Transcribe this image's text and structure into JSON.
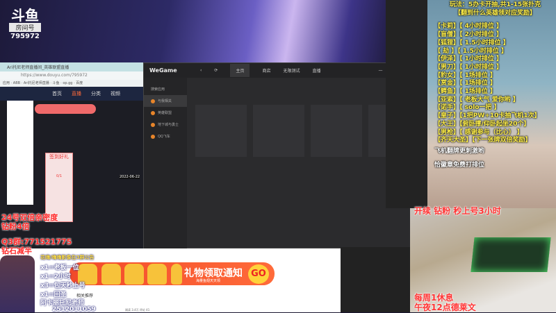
{
  "overlay": {
    "logo": "斗鱼",
    "room_label": "房间号",
    "room_id": "795972"
  },
  "browser": {
    "tab_title": "Ari托尼老师直播间_英雄联盟直播",
    "url": "https://www.douyu.com/795972",
    "bookmarks": [
      "应用",
      "ABB",
      "Ari托尼老师直播",
      "斗鱼",
      "op.gg",
      "百度"
    ],
    "nav": [
      "首页",
      "直播",
      "分类",
      "视频"
    ],
    "date": "2022-06-22",
    "gift_title": "签到好礼",
    "gift_count": "0/1"
  },
  "wegame": {
    "logo": "WeGame",
    "tabs": [
      "主页",
      "商店",
      "无限测试",
      "直播"
    ],
    "search": "搜索应用",
    "sidebar": [
      "与我相关",
      "英雄联盟",
      "地下城与勇士",
      "QQ飞车"
    ]
  },
  "rules": {
    "title": "玩法：5办卡开抽,共1-15张扑克",
    "subtitle": "【翻到什么英雄领对应奖励】",
    "items": [
      [
        "【卡莉】",
        "【  4小时排位  】"
      ],
      [
        "【盲僧】",
        "【  2小时排位  】"
      ],
      [
        "【狐狸】",
        "【 1.5小时排位 】"
      ],
      [
        "【 劫 】",
        "【 1.5小时排位 】"
      ],
      [
        "【伊泽】",
        "【  1小时排位  】"
      ],
      [
        "【男刀】",
        "【  1小时排位  】"
      ],
      [
        "【豹女】",
        "【  1场排位  】"
      ],
      [
        "【赏金】",
        "【  1场排位  】"
      ],
      [
        "【鳄鱼】",
        "【  1场排位  】"
      ],
      [
        "【亚索】",
        "【 老板大气 爱你哟 】"
      ],
      [
        "【诺手】",
        "【  solo一把  】"
      ],
      [
        "【皇子】",
        "【1把PW+10卡抽飞机1次】"
      ],
      [
        "【大王】",
        "【俯卧撑/仰卧起坐20个】"
      ],
      [
        "【男枪】",
        "【 感谢参与（比心） 】"
      ],
      [
        "【齐天大圣】",
        "【下一张牌双倍奖励】"
      ]
    ],
    "note1": "飞机翻牌更刺激哟",
    "note2": "恰徽章免费打排位"
  },
  "cam": {
    "top": "开续 钻粉 秒上号3小时",
    "b1": "每周1休息",
    "b2": "午夜12点德莱文"
  },
  "left": {
    "l1": "24号双倍亲密度",
    "l2": "钻粉4倍",
    "l3": "Q3群:771521775",
    "l4": "钻石减半"
  },
  "chat": {
    "header": "花嗨/嗨嗨影像在3群公告",
    "lines": [
      "x1=老板一位",
      "x1=2小时",
      "x3=包天秒上号",
      "x1=回圣",
      "阿卡丽托尼老师",
      "2512011059"
    ],
    "related": "相关推荐",
    "stats": "阅读 3.4万  评论 41"
  },
  "banner": {
    "title": "礼物领取通知",
    "sub": "海量鱼翅天天领",
    "go": "GO"
  }
}
